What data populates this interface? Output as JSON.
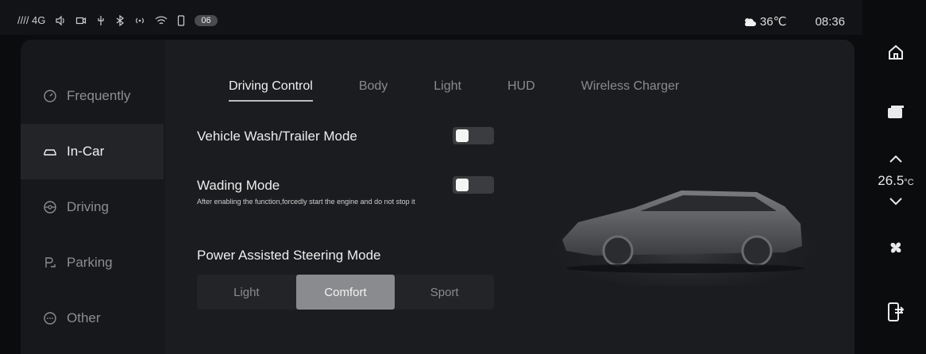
{
  "status_bar": {
    "signal": "//// 4G",
    "notification_count": "06",
    "temperature": "36℃",
    "time": "08:36"
  },
  "nav": {
    "items": [
      {
        "label": "Frequently",
        "icon": "gauge-icon"
      },
      {
        "label": "In-Car",
        "icon": "car-outline-icon"
      },
      {
        "label": "Driving",
        "icon": "steering-wheel-icon"
      },
      {
        "label": "Parking",
        "icon": "parking-icon"
      },
      {
        "label": "Other",
        "icon": "more-icon"
      }
    ],
    "active_index": 1
  },
  "tabs": {
    "items": [
      "Driving Control",
      "Body",
      "Light",
      "HUD",
      "Wireless Charger"
    ],
    "active_index": 0
  },
  "settings": {
    "vehicle_wash": {
      "label": "Vehicle Wash/Trailer Mode",
      "enabled": false
    },
    "wading": {
      "label": "Wading Mode",
      "description": "After enabling the function,forcedly start the engine and do not stop it",
      "enabled": false
    },
    "steering": {
      "label": "Power Assisted Steering Mode",
      "options": [
        "Light",
        "Comfort",
        "Sport"
      ],
      "selected": "Comfort"
    }
  },
  "climate": {
    "temperature_value": "26.5",
    "temperature_unit": "°C"
  },
  "colors": {
    "background": "#0b0c0e",
    "panel": "#17181b",
    "active_segment": "#8a8b8e"
  }
}
